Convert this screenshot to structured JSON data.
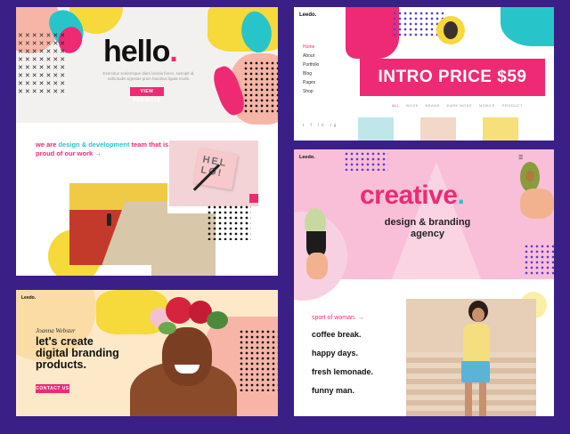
{
  "panel_hello": {
    "title": "hello",
    "dot": ".",
    "tagline": "Exercitus scelerisque diam lacinia fusce, suscipit id, sollicitudin egestas proin faucibus ligula morbi.",
    "cta_label": "VIEW PROJECTS",
    "headline_prefix": "we are ",
    "headline_accent": "design & development",
    "headline_suffix": " team that is proud of our work",
    "headline_arrow": "→",
    "card_text": "HEL LO!"
  },
  "panel_intro": {
    "logo": "Leedo.",
    "nav": [
      "Home",
      "About",
      "Portfolio",
      "Blog",
      "Pages",
      "Shop"
    ],
    "price_banner": "INTRO PRICE $59",
    "subnav": [
      "ALL",
      "BOOK",
      "BRAND",
      "DARK MODE",
      "MOBILE",
      "PRODUCT"
    ],
    "social": [
      "t",
      "f",
      "in",
      "ig"
    ]
  },
  "panel_creative": {
    "logo": "Leedo.",
    "title": "creative",
    "dot": ".",
    "subtitle_line1": "design & branding",
    "subtitle_line2": "agency",
    "sport_label": "sport of woman.",
    "sport_arrow": "→",
    "list": [
      "coffee break.",
      "happy days.",
      "fresh lemonade.",
      "funny man."
    ]
  },
  "panel_branding": {
    "logo": "Leedo.",
    "signature": "Joanna Webster",
    "headline_line1": "let's create",
    "headline_line2": "digital branding",
    "headline_line3": "products.",
    "cta_label": "CONTACT US"
  },
  "colors": {
    "background": "#3a1f86",
    "pink": "#ee2a74",
    "teal": "#27c5c9",
    "yellow": "#f6d93a",
    "peach": "#f6b5a6"
  }
}
